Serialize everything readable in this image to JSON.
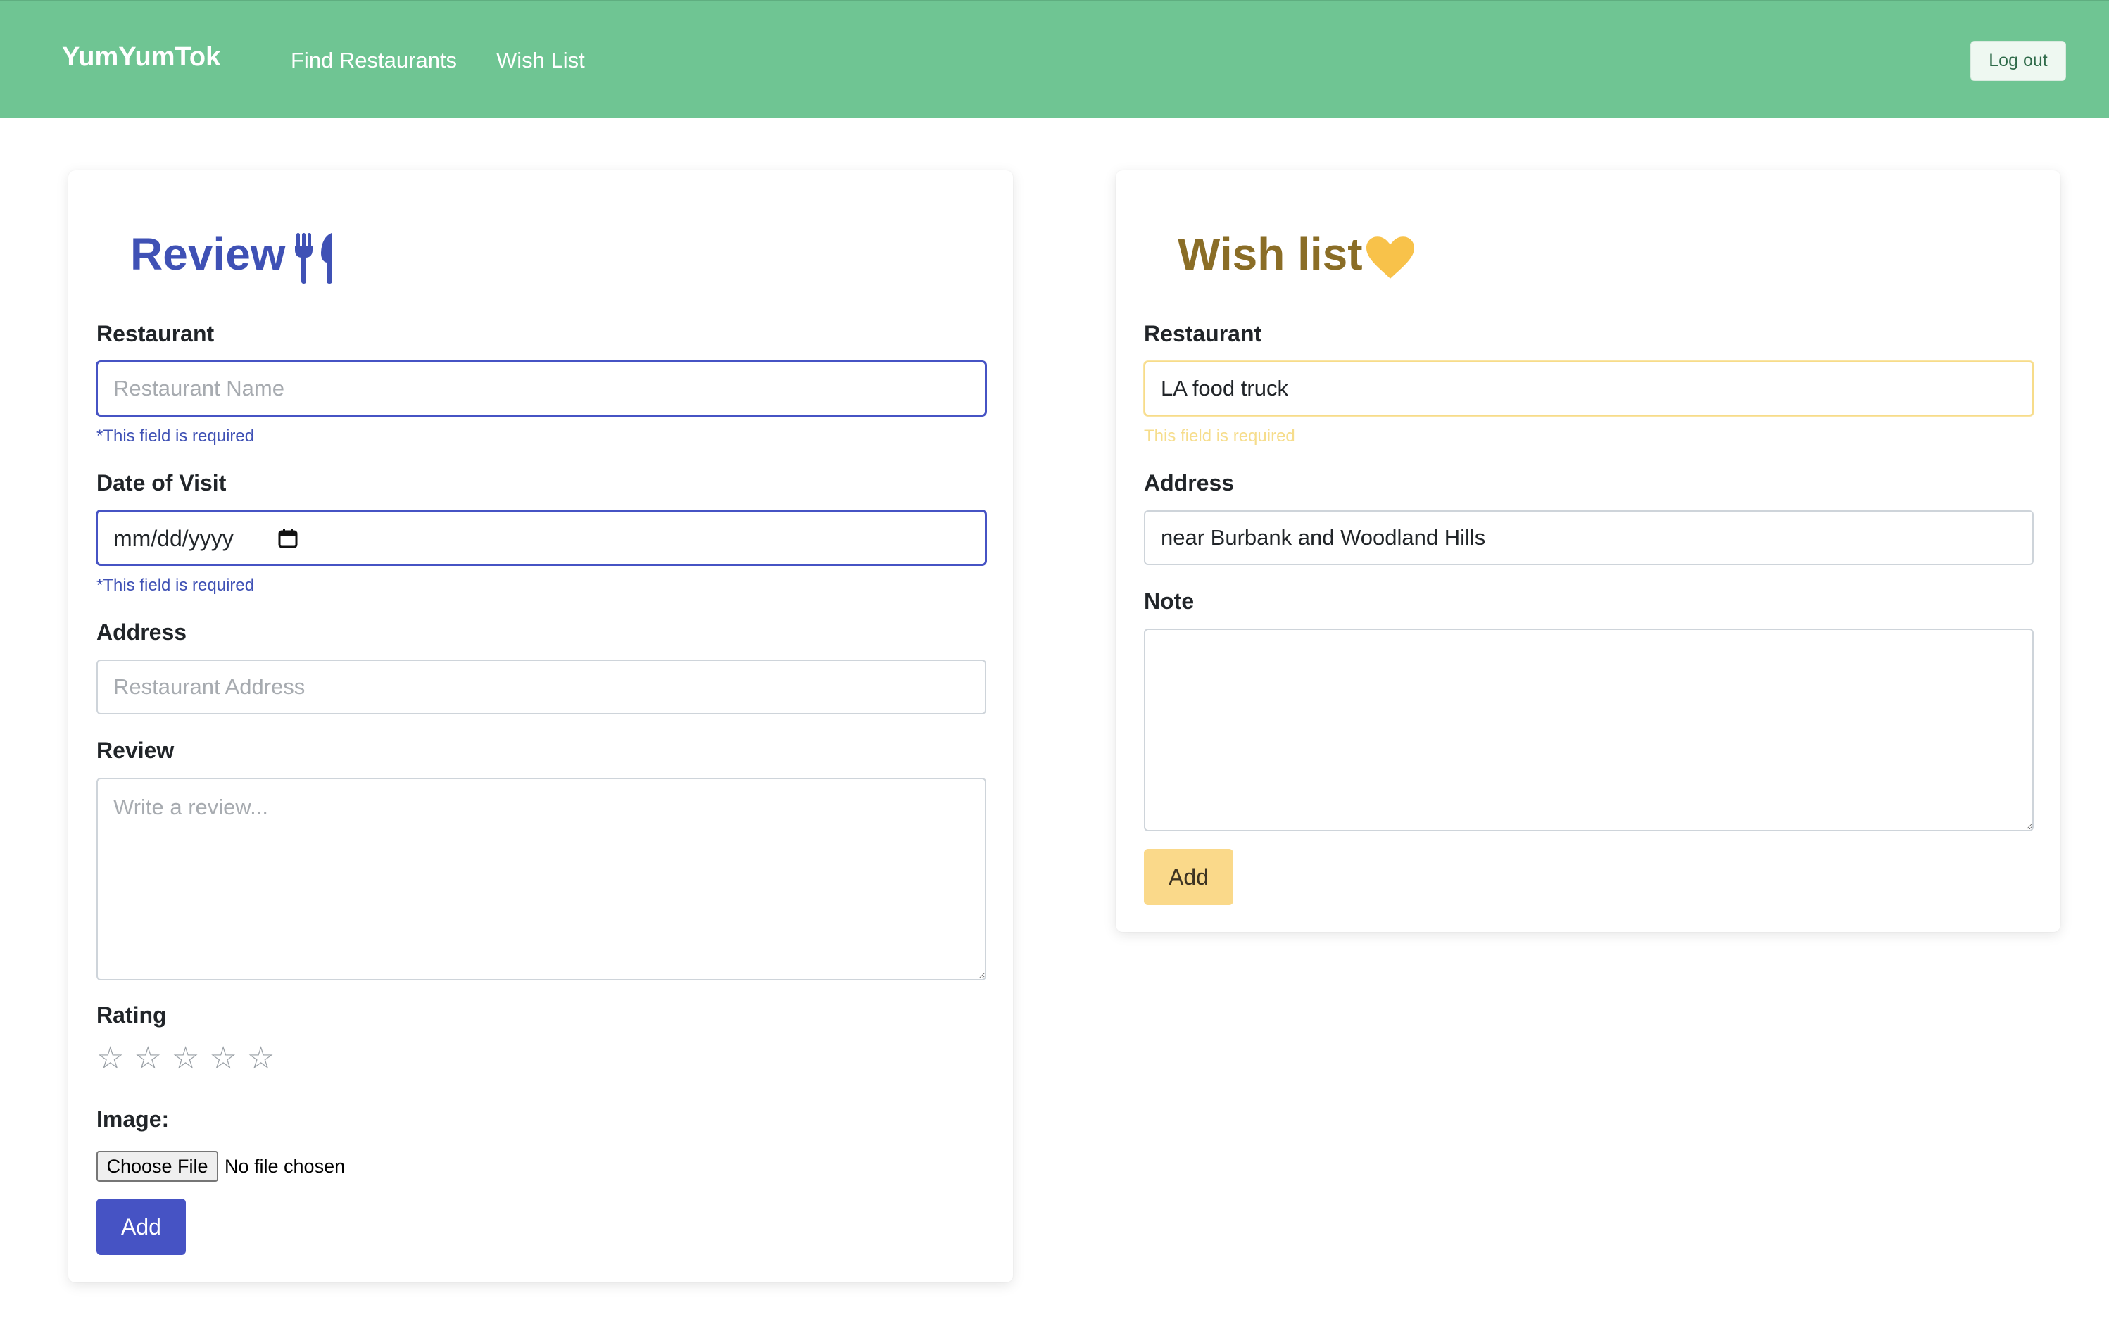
{
  "navbar": {
    "brand": "YumYumTok",
    "links": [
      "Find Restaurants",
      "Wish List"
    ],
    "logout_label": "Log out",
    "background_color": "#6fc593"
  },
  "review_form": {
    "title": "Review",
    "title_icon": "utensils-icon",
    "accent_color": "#3f51b5",
    "restaurant": {
      "label": "Restaurant",
      "placeholder": "Restaurant Name",
      "value": "",
      "hint": "*This field is required"
    },
    "date": {
      "label": "Date of Visit",
      "display": "mm/dd/yyyy",
      "hint": "*This field is required"
    },
    "address": {
      "label": "Address",
      "placeholder": "Restaurant Address",
      "value": ""
    },
    "review": {
      "label": "Review",
      "placeholder": "Write a review..."
    },
    "rating": {
      "label": "Rating",
      "value": 0,
      "max": 5
    },
    "image": {
      "label": "Image:",
      "button_label": "Choose File",
      "status": "No file chosen"
    },
    "submit_label": "Add"
  },
  "wish_form": {
    "title": "Wish list",
    "title_icon": "heart-icon",
    "accent_color": "#f8c24a",
    "restaurant": {
      "label": "Restaurant",
      "value": "LA food truck",
      "hint": "This field is required"
    },
    "address": {
      "label": "Address",
      "value": "near Burbank and Woodland Hills"
    },
    "note": {
      "label": "Note",
      "value": ""
    },
    "submit_label": "Add"
  }
}
